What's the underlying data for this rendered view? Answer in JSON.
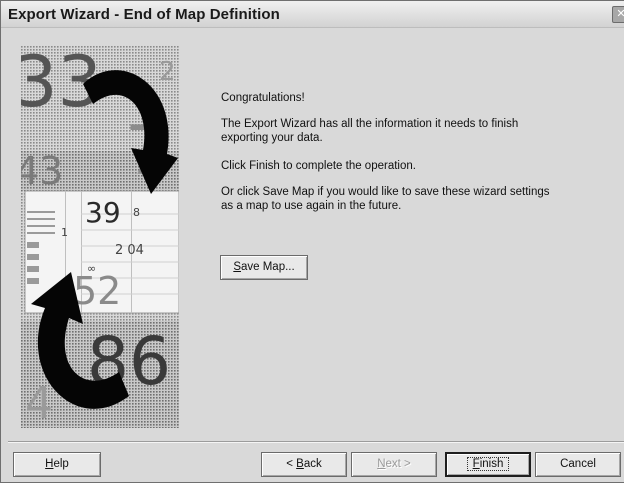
{
  "window": {
    "title": "Export Wizard - End of Map Definition",
    "close_glyph": "✕"
  },
  "art": {
    "numbers": [
      "33",
      "2",
      "7",
      "43",
      "39",
      "8",
      "1",
      "2 04",
      "∞",
      "52",
      "86",
      "4"
    ]
  },
  "content": {
    "heading": "Congratulations!",
    "message": "The Export Wizard has all the information it needs to finish exporting your data.",
    "finish_hint": "Click Finish to complete the operation.",
    "save_hint": "Or click Save Map if you would like to save these wizard settings as a map to use again in the future."
  },
  "buttons": {
    "save_map": {
      "mnemonic": "S",
      "rest": "ave Map..."
    },
    "help": {
      "mnemonic": "H",
      "rest": "elp"
    },
    "back": {
      "prefix": "< ",
      "mnemonic": "B",
      "rest": "ack"
    },
    "next": {
      "mnemonic": "N",
      "rest": "ext >"
    },
    "finish": {
      "mnemonic": "F",
      "rest": "inish"
    },
    "cancel": {
      "label": "Cancel"
    }
  }
}
